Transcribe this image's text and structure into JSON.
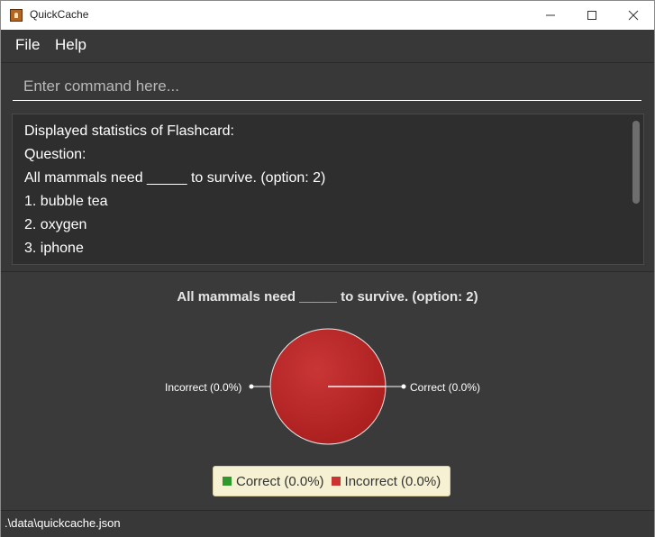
{
  "window": {
    "title": "QuickCache"
  },
  "menu": {
    "items": [
      "File",
      "Help"
    ]
  },
  "command": {
    "placeholder": "Enter command here...",
    "value": ""
  },
  "result": {
    "lines": [
      "Displayed statistics of Flashcard:",
      "Question:",
      "All mammals need _____ to survive. (option: 2)",
      "1. bubble tea",
      "2. oxygen",
      "3. iphone"
    ]
  },
  "chart_data": {
    "type": "pie",
    "title": "All mammals need _____ to survive. (option: 2)",
    "slices": [
      {
        "label": "Correct (0.0%)",
        "name": "Correct",
        "value": 0.0,
        "color": "#2e9a2e"
      },
      {
        "label": "Incorrect (0.0%)",
        "name": "Incorrect",
        "value": 0.0,
        "color": "#cc3333"
      }
    ],
    "legend_position": "bottom",
    "pie_fill": "#b52424"
  },
  "legend": [
    "Correct (0.0%)",
    "Incorrect (0.0%)"
  ],
  "status": {
    "path": ".\\data\\quickcache.json"
  },
  "icons": {
    "minimize": "minimize-icon",
    "maximize": "maximize-icon",
    "close": "close-icon",
    "app": "app-icon"
  }
}
